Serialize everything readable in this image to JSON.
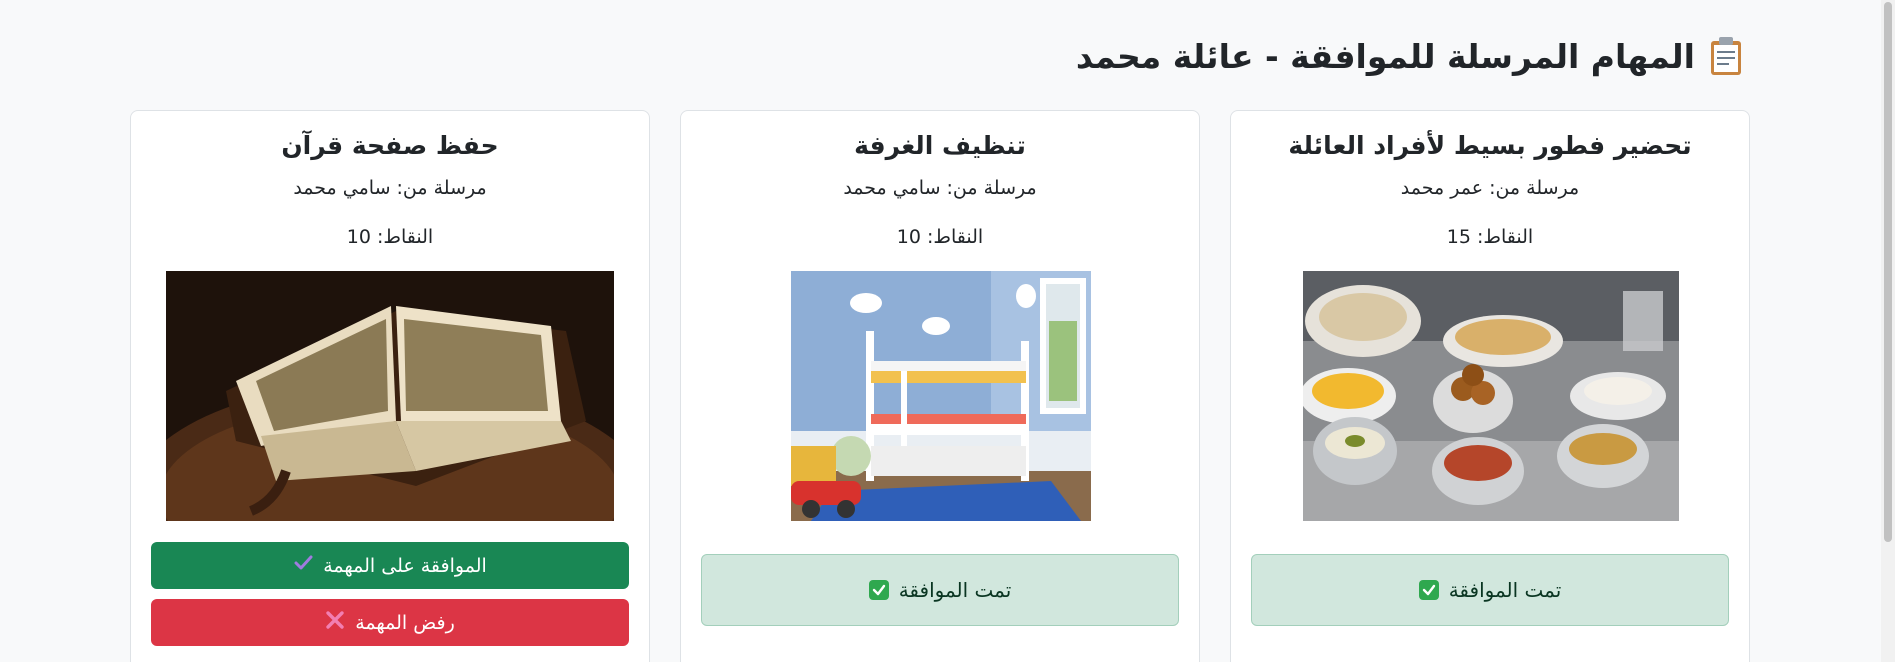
{
  "header": {
    "title": "المهام المرسلة للموافقة - عائلة محمد",
    "icon": "clipboard-icon"
  },
  "cards": [
    {
      "title": "تحضير فطور بسيط لأفراد العائلة",
      "sender": "مرسلة من: عمر محمد",
      "points": "النقاط: 15",
      "image": "breakfast-image",
      "status": "تمت الموافقة"
    },
    {
      "title": "تنظيف الغرفة",
      "sender": "مرسلة من: سامي محمد",
      "points": "النقاط: 10",
      "image": "bedroom-image",
      "status": "تمت الموافقة"
    },
    {
      "title": "حفظ صفحة قرآن",
      "sender": "مرسلة من: سامي محمد",
      "points": "النقاط: 10",
      "image": "quran-image",
      "approve_label": "الموافقة على المهمة",
      "reject_label": "رفض المهمة"
    }
  ],
  "colors": {
    "approve": "#198754",
    "reject": "#dc3545",
    "approved_bg": "#d1e7dd"
  }
}
